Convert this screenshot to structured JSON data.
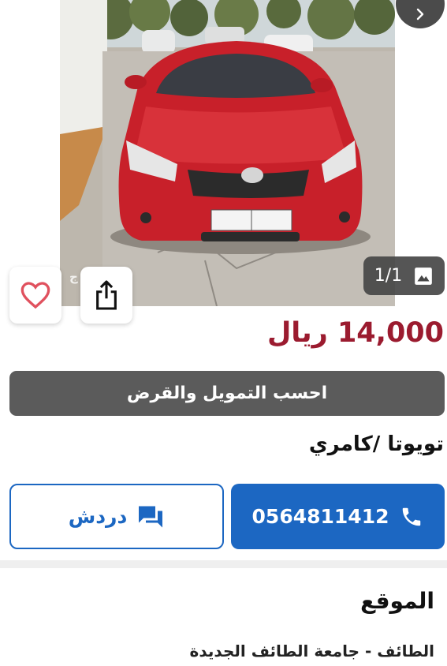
{
  "gallery": {
    "counter": "1/1",
    "watermark": "ال... ج"
  },
  "listing": {
    "price": "14,000 ريال",
    "finance_button": "احسب التمويل والقرض",
    "title": "تويوتا /كامري"
  },
  "actions": {
    "call_label": "0564811412",
    "chat_label": "دردش"
  },
  "location": {
    "heading": "الموقع",
    "value": "الطائف - جامعة الطائف الجديدة"
  },
  "colors": {
    "price": "#9b1b2f",
    "primary": "#1c67c2",
    "finance_bg": "#5b5b5b",
    "heart": "#e0515e"
  },
  "icons": [
    "chevron-right-icon",
    "image-icon",
    "heart-icon",
    "share-icon",
    "phone-icon",
    "chat-icon"
  ]
}
